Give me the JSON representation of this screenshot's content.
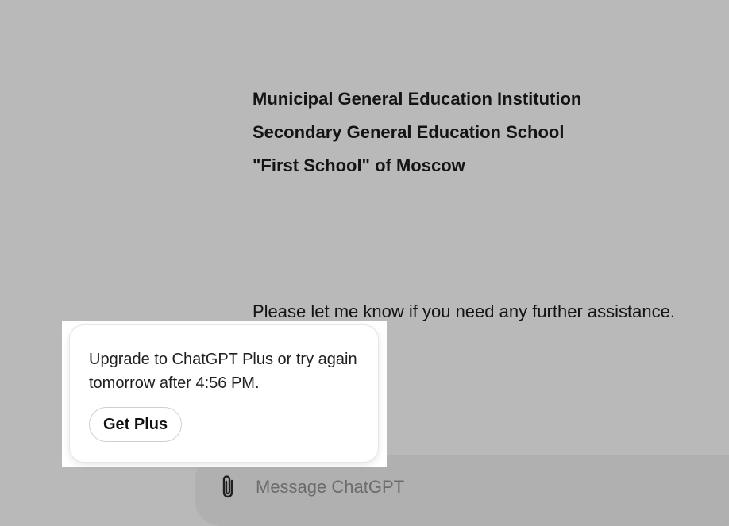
{
  "conversation": {
    "school_name_lines": [
      "Municipal General Education Institution",
      "Secondary General Education School",
      "\"First School\" of Moscow"
    ],
    "closing_message": "Please let me know if you need any further assistance."
  },
  "composer": {
    "placeholder": "Message ChatGPT",
    "attach_icon": "paperclip-icon"
  },
  "limit_popup": {
    "message": "Upgrade to ChatGPT Plus or try again tomorrow after 4:56 PM.",
    "button_label": "Get Plus"
  },
  "colors": {
    "overlay_background": "#b9b9b9",
    "popup_background": "#ffffff"
  }
}
